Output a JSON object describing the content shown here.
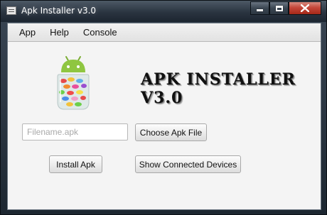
{
  "window": {
    "title": "Apk Installer v3.0"
  },
  "menubar": {
    "items": [
      "App",
      "Help",
      "Console"
    ]
  },
  "main": {
    "heading": "APK INSTALLER V3.0",
    "filename_placeholder": "Filename.apk",
    "filename_value": "",
    "choose_button": "Choose Apk File",
    "install_button": "Install Apk",
    "devices_button": "Show Connected Devices"
  },
  "icons": {
    "logo": "android-jelly-bean-jar-icon",
    "app": "window-app-icon",
    "minimize": "minimize-icon",
    "maximize": "maximize-icon",
    "close": "close-icon"
  },
  "colors": {
    "android_green": "#8fc641",
    "close_red": "#c5473a"
  }
}
